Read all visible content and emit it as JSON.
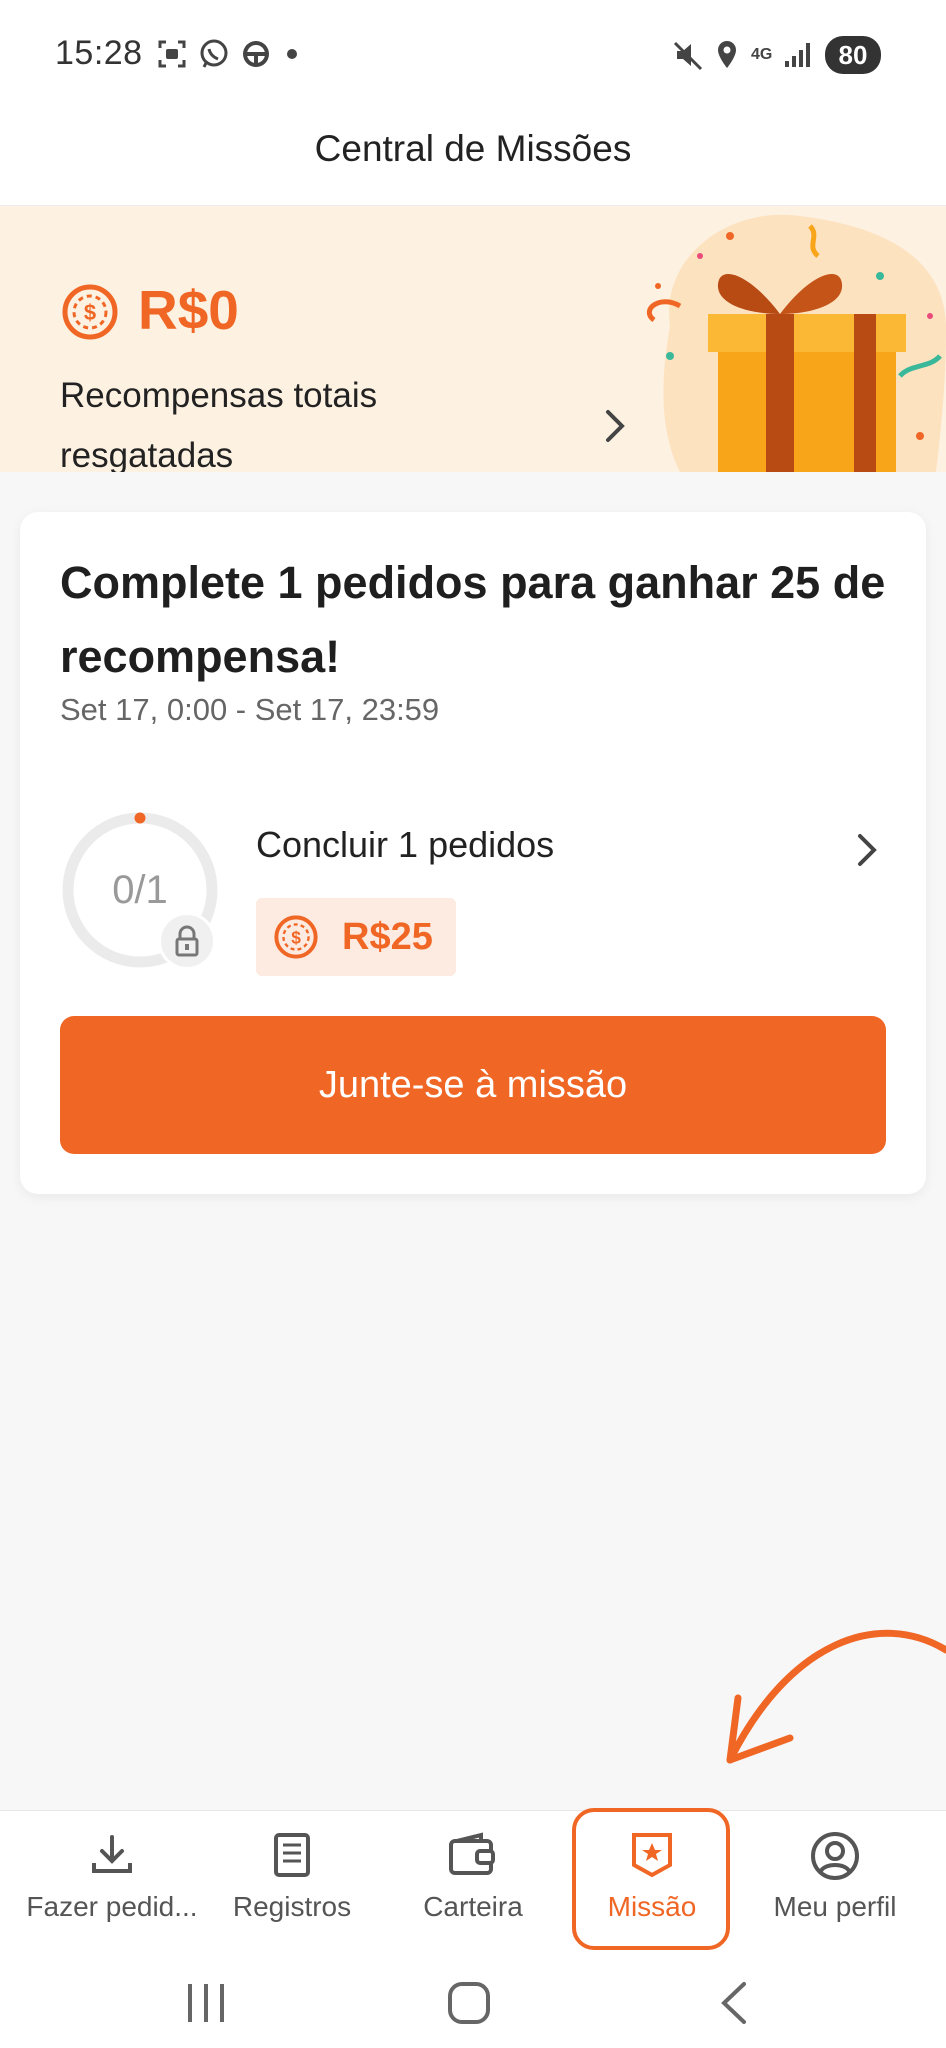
{
  "status_bar": {
    "time": "15:28",
    "left_icons": [
      "screenshot-icon",
      "whatsapp-icon",
      "steering-wheel-icon",
      "dot-icon"
    ],
    "right_icons": [
      "mute-icon",
      "location-icon",
      "network-4g-icon",
      "signal-icon"
    ],
    "network_label": "4G",
    "battery": "80"
  },
  "header": {
    "title": "Central de Missões"
  },
  "banner": {
    "amount": "R$0",
    "label": "Recompensas totais resgatadas",
    "icon": "coin-icon",
    "illustration": "gift-box-icon"
  },
  "mission": {
    "title": "Complete 1 pedidos para ganhar 25 de recompensa!",
    "dates": "Set 17, 0:00 - Set 17, 23:59",
    "progress_text": "0/1",
    "progress_fraction": 0,
    "task_label": "Concluir 1 pedidos",
    "reward": "R$25",
    "join_label": "Junte-se à missão"
  },
  "bottom_nav": {
    "items": [
      {
        "label": "Fazer pedid...",
        "icon": "download-icon"
      },
      {
        "label": "Registros",
        "icon": "document-icon"
      },
      {
        "label": "Carteira",
        "icon": "wallet-icon"
      },
      {
        "label": "Missão",
        "icon": "mission-badge-icon",
        "active": true
      },
      {
        "label": "Meu perfil",
        "icon": "profile-icon"
      }
    ]
  },
  "colors": {
    "accent": "#f06625",
    "banner_bg": "#fdf1e1",
    "reward_bg": "#fdeae0"
  }
}
